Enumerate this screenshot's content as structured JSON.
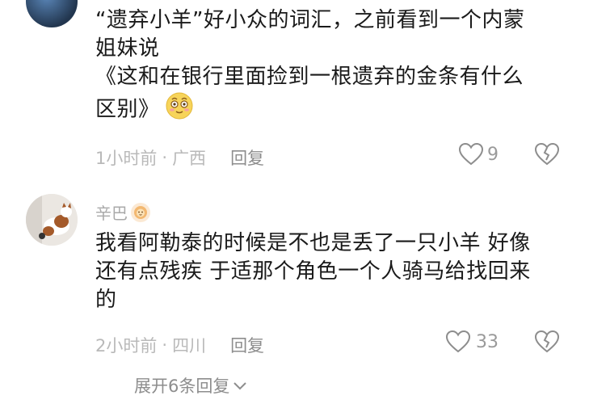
{
  "comment1": {
    "text_lines": [
      "“遗弃小羊”好小众的词汇，之前看到一个内蒙",
      "姐妹说",
      "《这和在银行里面捡到一根遗弃的金条有什么",
      "区别》"
    ],
    "time": "1小时前",
    "separator": "·",
    "location": "广西",
    "reply_label": "回复",
    "likes": "9"
  },
  "comment2": {
    "username": "辛巴",
    "text_lines": [
      "我看阿勒泰的时候是不也是丢了一只小羊 好像",
      "还有点残疾 于适那个角色一个人骑马给找回来",
      "的"
    ],
    "time": "2小时前",
    "separator": "·",
    "location": "四川",
    "reply_label": "回复",
    "likes": "33"
  },
  "expand_replies": "展开6条回复",
  "icons": {
    "like": "heart-outline-icon",
    "dislike": "broken-heart-icon",
    "emoji": "dizzy-face-emoji-icon",
    "badge": "lion-badge-icon",
    "expand": "chevron-down-icon"
  }
}
